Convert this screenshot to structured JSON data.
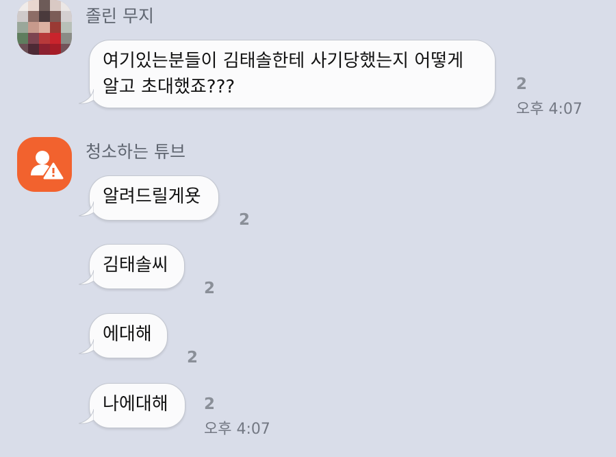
{
  "messages": [
    {
      "sender": "졸린 무지",
      "text_line1": "여기있는분들이 김태솔한테 사기당했는지 어떻게",
      "text_line2": "알고 초대했죠???",
      "unread": "2",
      "time": "오후 4:07"
    },
    {
      "sender": "청소하는 튜브",
      "bubbles": [
        {
          "text": "알려드릴게욧",
          "unread": "2"
        },
        {
          "text": "김태솔씨",
          "unread": "2"
        },
        {
          "text": "에대해",
          "unread": "2"
        },
        {
          "text": "나에대해",
          "unread": "2"
        }
      ],
      "time": "오후 4:07"
    }
  ],
  "colors": {
    "background": "#d9dde9",
    "bubble": "#fbfbfc",
    "avatar_warning": "#f2622e"
  },
  "icons": [
    "pixelated-profile-photo",
    "user-warning-icon"
  ]
}
